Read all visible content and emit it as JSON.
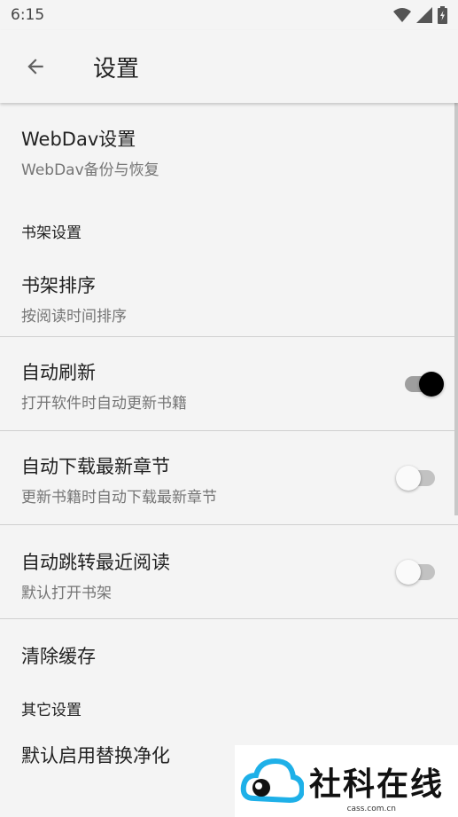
{
  "status_bar": {
    "time": "6:15",
    "icons": [
      "wifi-icon",
      "cell-signal-icon",
      "battery-charging-icon"
    ]
  },
  "toolbar": {
    "title": "设置",
    "back_icon": "arrow-left-icon"
  },
  "settings": {
    "webdav": {
      "title": "WebDav设置",
      "summary": "WebDav备份与恢复"
    },
    "bookshelf_category": "书架设置",
    "bookshelf_sort": {
      "title": "书架排序",
      "summary": "按阅读时间排序"
    },
    "auto_refresh": {
      "title": "自动刷新",
      "summary": "打开软件时自动更新书籍",
      "enabled": true
    },
    "auto_download": {
      "title": "自动下载最新章节",
      "summary": "更新书籍时自动下载最新章节",
      "enabled": false
    },
    "auto_jump": {
      "title": "自动跳转最近阅读",
      "summary": "默认打开书架",
      "enabled": false
    },
    "clear_cache": {
      "title": "清除缓存"
    },
    "other_category": "其它设置",
    "replace_purify": {
      "title": "默认启用替换净化"
    }
  },
  "watermark": {
    "text": "社科在线",
    "url": "cass.com.cn"
  }
}
